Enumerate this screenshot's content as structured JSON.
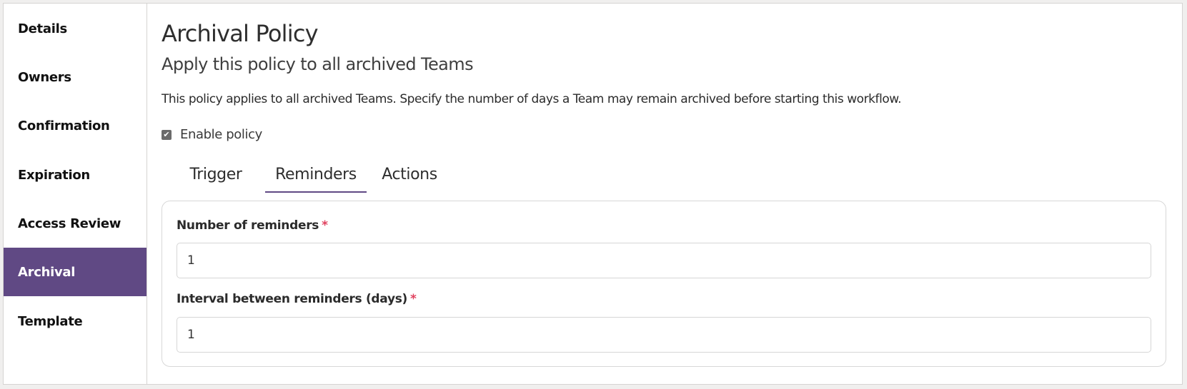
{
  "sidebar": {
    "items": [
      {
        "label": "Details",
        "active": false
      },
      {
        "label": "Owners",
        "active": false
      },
      {
        "label": "Confirmation",
        "active": false
      },
      {
        "label": "Expiration",
        "active": false
      },
      {
        "label": "Access Review",
        "active": false
      },
      {
        "label": "Archival",
        "active": true
      },
      {
        "label": "Template",
        "active": false
      }
    ]
  },
  "main": {
    "title": "Archival Policy",
    "subtitle": "Apply this policy to all archived Teams",
    "description": "This policy applies to all archived Teams. Specify the number of days a Team may remain archived before starting this workflow.",
    "enable_policy": {
      "label": "Enable policy",
      "checked": true,
      "icon": "check-icon"
    },
    "tabs": [
      {
        "label": "Trigger",
        "active": false
      },
      {
        "label": "Reminders",
        "active": true
      },
      {
        "label": "Actions",
        "active": false
      }
    ],
    "form": {
      "fields": [
        {
          "label": "Number of reminders",
          "required_mark": "*",
          "value": "1"
        },
        {
          "label": "Interval between reminders (days)",
          "required_mark": "*",
          "value": "1"
        }
      ]
    }
  },
  "colors": {
    "accent": "#604984",
    "required": "#e0415e"
  }
}
